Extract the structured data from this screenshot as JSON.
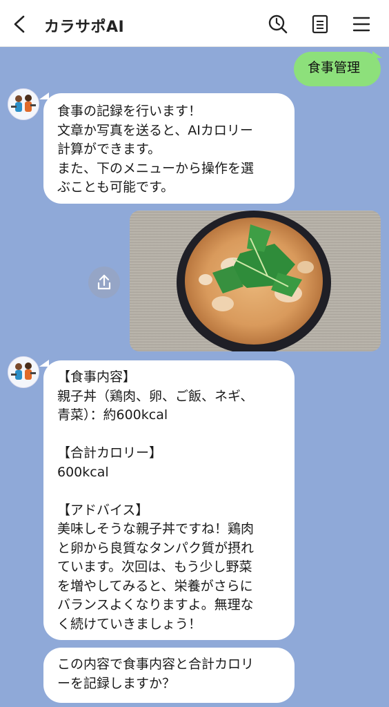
{
  "header": {
    "title": "カラサポAI"
  },
  "messages": {
    "user_menu": "食事管理",
    "intro": "食事の記録を行います！\n文章か写真を送ると、AIカロリー\n計算ができます。\nまた、下のメニューから操作を選\nぶことも可能です。",
    "analysis": "【食事内容】\n親子丼（鶏肉、卵、ご飯、ネギ、\n青菜）：約600kcal\n\n【合計カロリー】\n600kcal\n\n【アドバイス】\n美味しそうな親子丼ですね！鶏肉\nと卵から良質なタンパク質が摂れ\nています。次回は、もう少し野菜\nを増やしてみると、栄養がさらに\nバランスよくなりますよ。無理な\nく続けていきましょう！",
    "confirm": "この内容で食事内容と合計カロリ\nーを記録しますか？"
  },
  "icons": {
    "back": "chevron-left-icon",
    "search": "search-history-icon",
    "notes": "notes-icon",
    "menu": "hamburger-menu-icon",
    "share": "share-icon"
  },
  "colors": {
    "chat_background": "#8fa9d8",
    "user_bubble": "#8de07b",
    "bot_bubble": "#ffffff"
  }
}
